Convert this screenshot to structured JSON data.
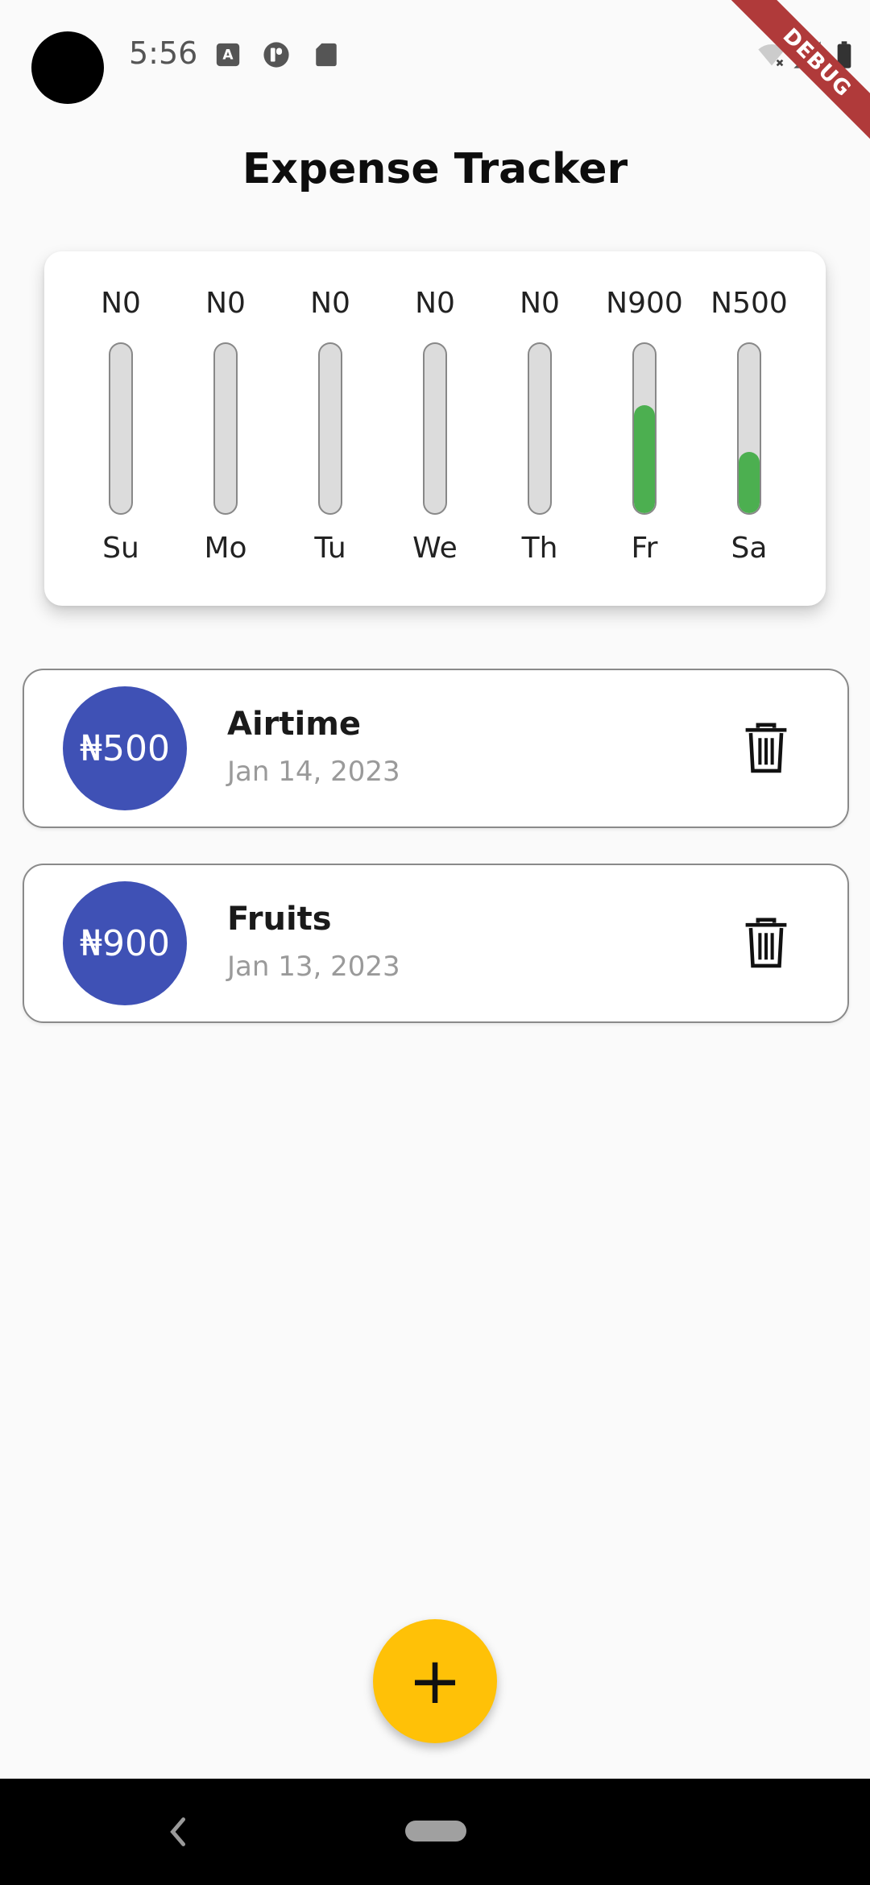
{
  "status_bar": {
    "time": "5:56",
    "debug_label": "DEBUG"
  },
  "app": {
    "title": "Expense Tracker"
  },
  "chart_data": {
    "type": "bar",
    "categories": [
      "Su",
      "Mo",
      "Tu",
      "We",
      "Th",
      "Fr",
      "Sa"
    ],
    "value_labels": [
      "N0",
      "N0",
      "N0",
      "N0",
      "N0",
      "N900",
      "N500"
    ],
    "values": [
      0,
      0,
      0,
      0,
      0,
      900,
      500
    ],
    "fill_fraction": [
      0,
      0,
      0,
      0,
      0,
      0.64,
      0.36
    ],
    "colors": {
      "fill": "#4caf50",
      "track": "#dcdcdc"
    }
  },
  "expenses": [
    {
      "amount": "₦500",
      "title": "Airtime",
      "date": "Jan 14, 2023"
    },
    {
      "amount": "₦900",
      "title": "Fruits",
      "date": "Jan 13, 2023"
    }
  ],
  "colors": {
    "amount_circle": "#3f51b5",
    "fab": "#ffc107",
    "background": "#fafafa"
  },
  "icons": {
    "delete": "trash-icon",
    "add": "plus-icon",
    "back": "chevron-left-icon"
  },
  "fab": {
    "label": "+"
  }
}
